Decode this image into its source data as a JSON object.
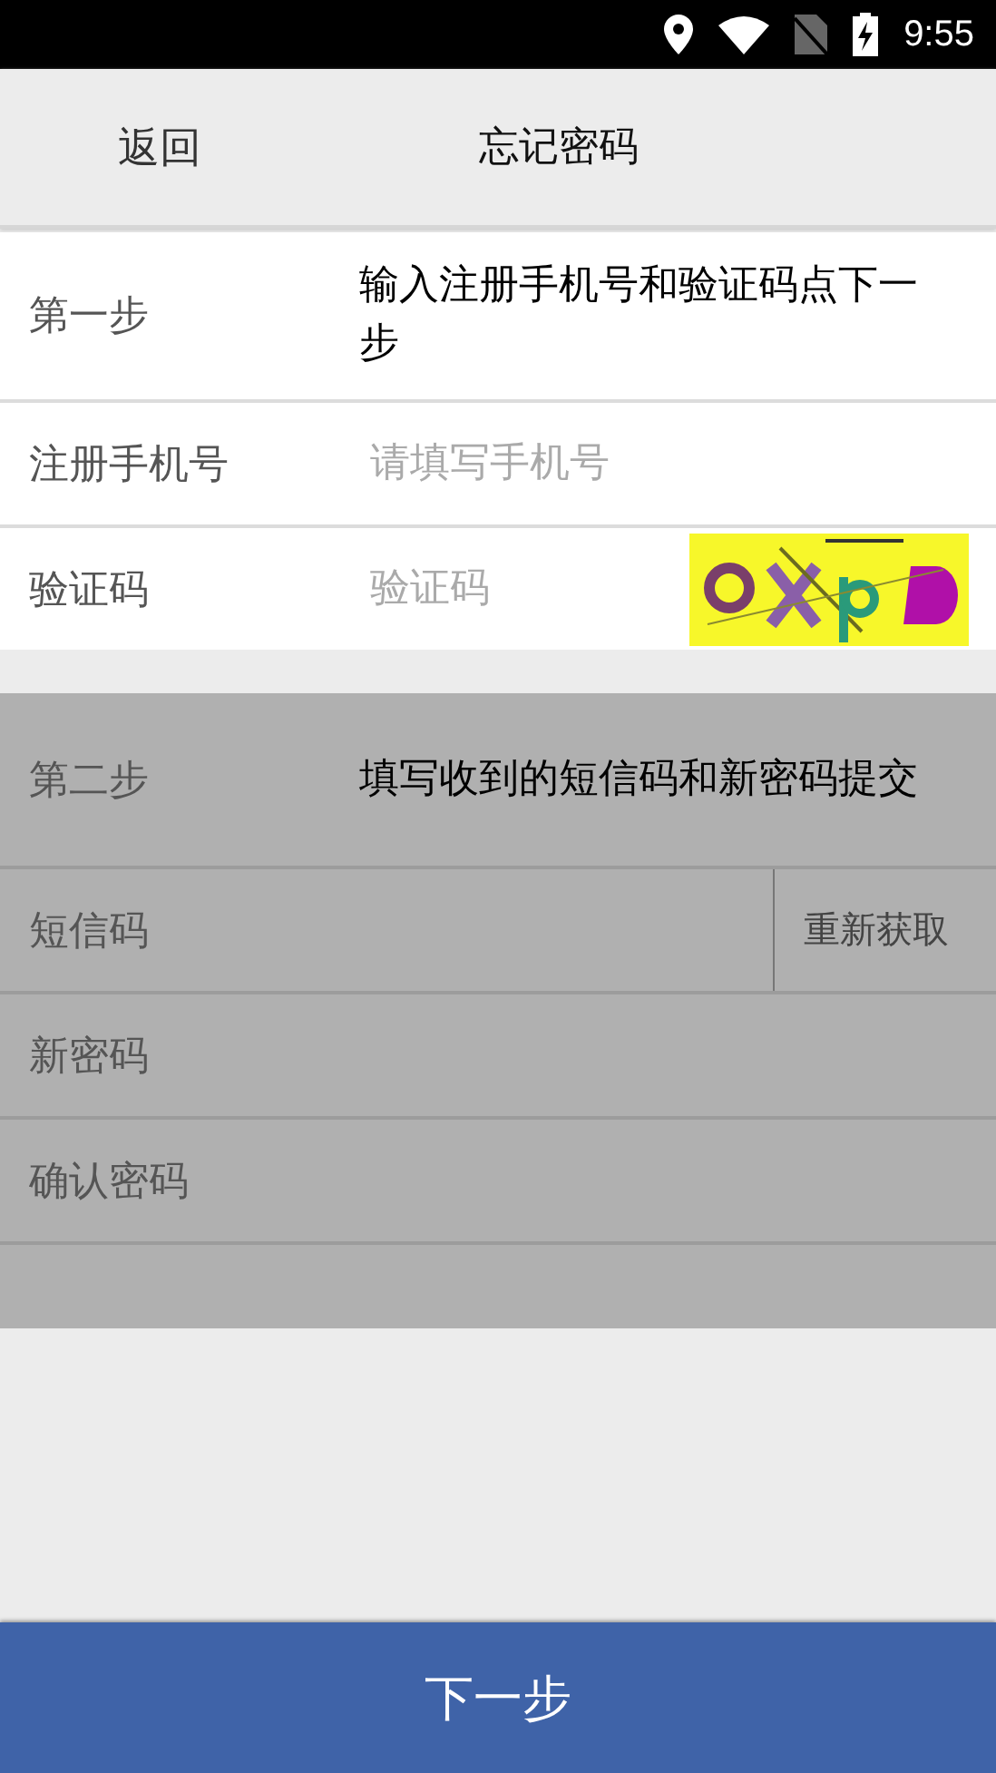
{
  "status_bar": {
    "time": "9:55"
  },
  "header": {
    "back": "返回",
    "title": "忘记密码"
  },
  "step1": {
    "disabled": false,
    "label": "第一步",
    "hint": "输入注册手机号和验证码点下一步",
    "fields": [
      {
        "kind": "input",
        "label": "注册手机号",
        "placeholder": "请填写手机号"
      },
      {
        "kind": "captcha",
        "label": "验证码",
        "placeholder": "验证码"
      }
    ]
  },
  "step2": {
    "disabled": true,
    "label": "第二步",
    "hint": "填写收到的短信码和新密码提交",
    "fields": [
      {
        "kind": "resend",
        "label": "短信码",
        "button": "重新获取"
      },
      {
        "kind": "input",
        "label": "新密码"
      },
      {
        "kind": "input",
        "label": "确认密码"
      }
    ]
  },
  "next_button": "下一步"
}
